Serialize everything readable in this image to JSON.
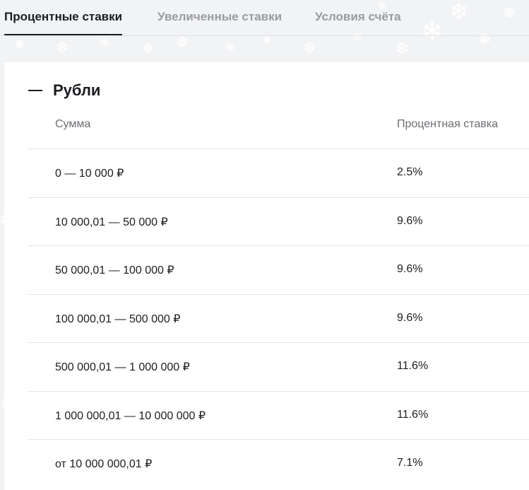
{
  "tabs": [
    {
      "label": "Процентные ставки",
      "active": true
    },
    {
      "label": "Увеличенные ставки",
      "active": false
    },
    {
      "label": "Условия счёта",
      "active": false
    }
  ],
  "section": {
    "title": "Рубли",
    "collapse_icon": "minus-icon"
  },
  "table": {
    "headers": {
      "amount": "Сумма",
      "rate": "Процентная ставка"
    },
    "rows": [
      {
        "amount": "0 — 10 000 ₽",
        "rate": "2.5%"
      },
      {
        "amount": "10 000,01 — 50 000 ₽",
        "rate": "9.6%"
      },
      {
        "amount": "50 000,01 — 100 000 ₽",
        "rate": "9.6%"
      },
      {
        "amount": "100 000,01 — 500 000 ₽",
        "rate": "9.6%"
      },
      {
        "amount": "500 000,01 — 1 000 000 ₽",
        "rate": "11.6%"
      },
      {
        "amount": "1 000 000,01 — 10 000 000 ₽",
        "rate": "11.6%"
      },
      {
        "amount": "от 10 000 000,01 ₽",
        "rate": "7.1%"
      }
    ]
  },
  "colors": {
    "background": "#f2f3f5",
    "text": "#1c1d22",
    "muted": "#9a9b9f",
    "divider": "#e3e4e7",
    "decor": "snowflake-pattern"
  }
}
